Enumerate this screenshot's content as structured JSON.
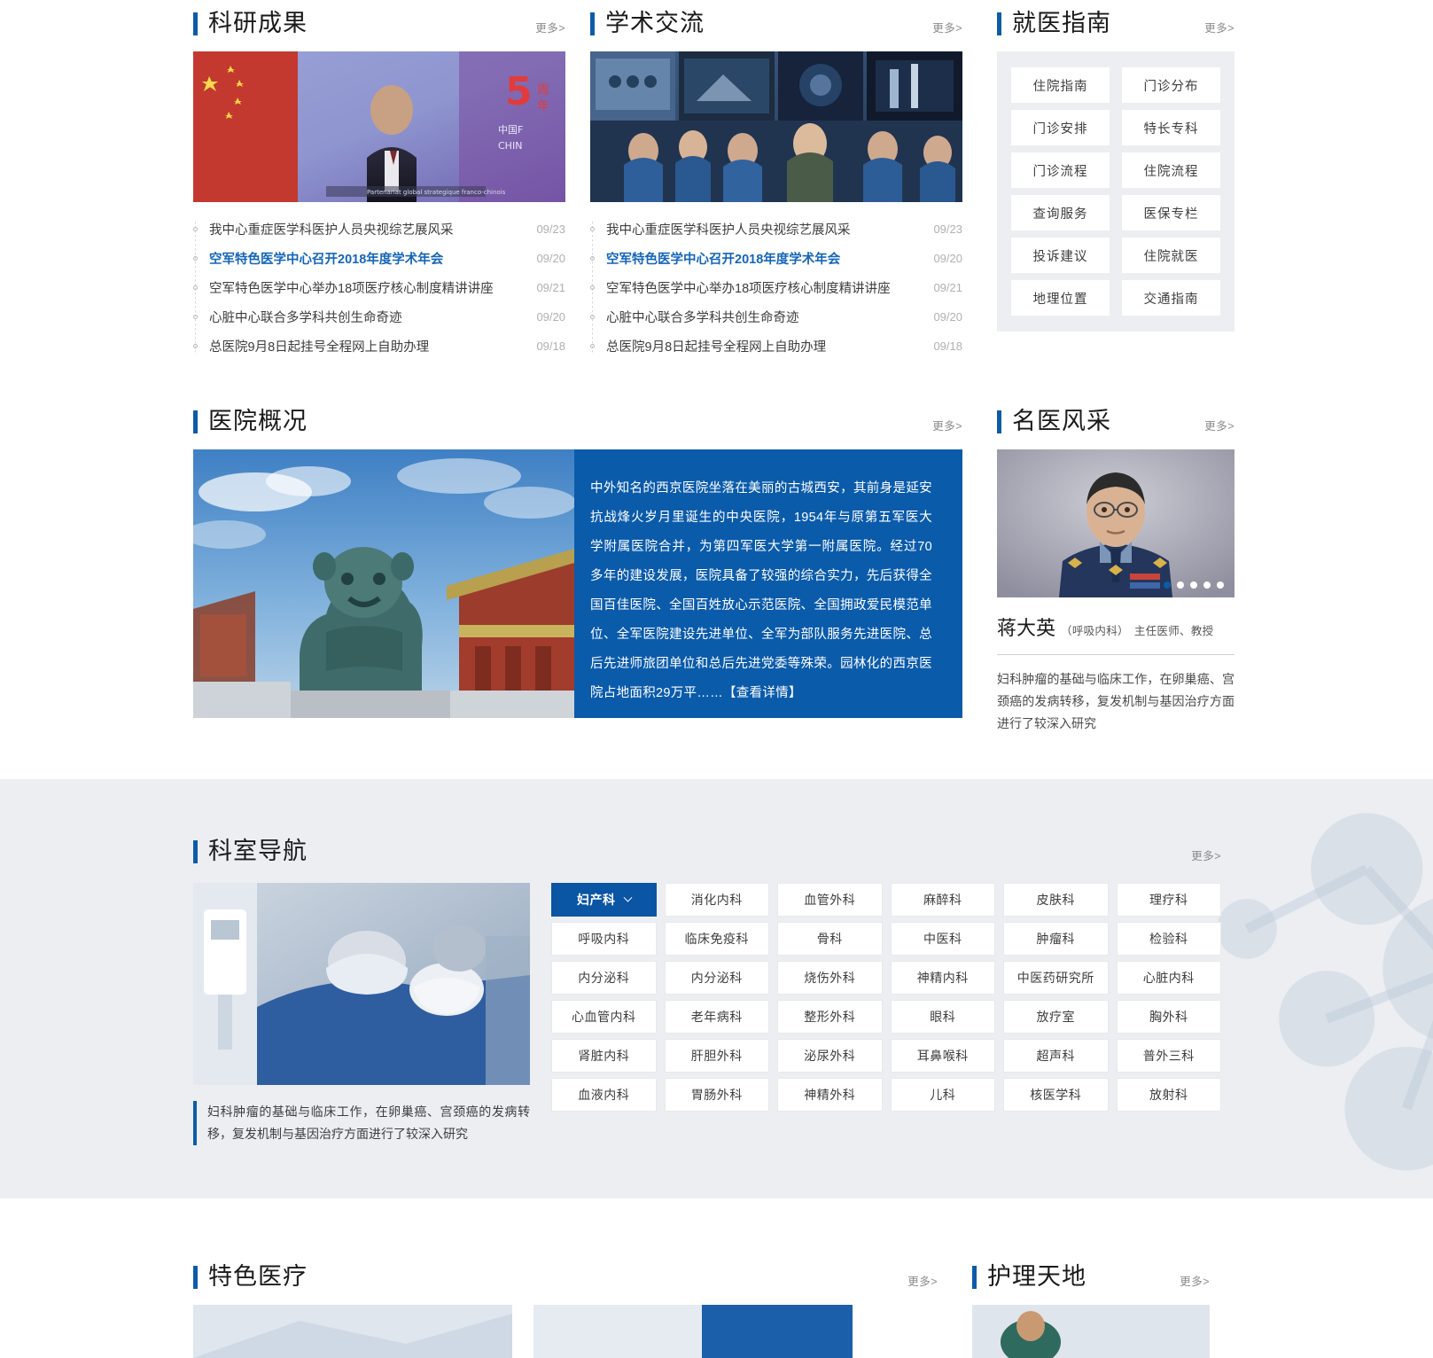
{
  "common": {
    "more_label": "更多>"
  },
  "research": {
    "title": "科研成果",
    "more_label": "更多>",
    "items": [
      {
        "text": "我中心重症医学科医护人员央视综艺展风采",
        "date": "09/23",
        "active": false
      },
      {
        "text": "空军特色医学中心召开2018年度学术年会",
        "date": "09/20",
        "active": true
      },
      {
        "text": "空军特色医学中心举办18项医疗核心制度精讲讲座",
        "date": "09/21",
        "active": false
      },
      {
        "text": "心脏中心联合多学科共创生命奇迹",
        "date": "09/20",
        "active": false
      },
      {
        "text": "总医院9月8日起挂号全程网上自助办理",
        "date": "09/18",
        "active": false
      }
    ]
  },
  "academic": {
    "title": "学术交流",
    "more_label": "更多>",
    "items": [
      {
        "text": "我中心重症医学科医护人员央视综艺展风采",
        "date": "09/23",
        "active": false
      },
      {
        "text": "空军特色医学中心召开2018年度学术年会",
        "date": "09/20",
        "active": true
      },
      {
        "text": "空军特色医学中心举办18项医疗核心制度精讲讲座",
        "date": "09/21",
        "active": false
      },
      {
        "text": "心脏中心联合多学科共创生命奇迹",
        "date": "09/20",
        "active": false
      },
      {
        "text": "总医院9月8日起挂号全程网上自助办理",
        "date": "09/18",
        "active": false
      }
    ]
  },
  "guide": {
    "title": "就医指南",
    "more_label": "更多>",
    "buttons": [
      "住院指南",
      "门诊分布",
      "门诊安排",
      "特长专科",
      "门诊流程",
      "住院流程",
      "查询服务",
      "医保专栏",
      "投诉建议",
      "住院就医",
      "地理位置",
      "交通指南"
    ]
  },
  "overview": {
    "title": "医院概况",
    "more_label": "更多>",
    "body": "中外知名的西京医院坐落在美丽的古城西安，其前身是延安抗战烽火岁月里诞生的中央医院，1954年与原第五军医大学附属医院合并，为第四军医大学第一附属医院。经过70多年的建设发展，医院具备了较强的综合实力，先后获得全国百佳医院、全国百姓放心示范医院、全国拥政爱民模范单位、全军医院建设先进单位、全军为部队服务先进医院、总后先进师旅团单位和总后先进党委等殊荣。园林化的西京医院占地面积29万平……",
    "detail_link": "【查看详情】"
  },
  "doctor": {
    "title": "名医风采",
    "more_label": "更多>",
    "name": "蒋大英",
    "department": "（呼吸内科）",
    "rank": "主任医师、教授",
    "bio": "妇科肿瘤的基础与临床工作，在卵巢癌、宫颈癌的发病转移，复发机制与基因治疗方面进行了较深入研究",
    "carousel_dots": 5,
    "carousel_active_index": 0
  },
  "departments": {
    "title": "科室导航",
    "more_label": "更多>",
    "caption": "妇科肿瘤的基础与临床工作，在卵巢癌、宫颈癌的发病转移，复发机制与基因治疗方面进行了较深入研究",
    "active_label": "妇产科",
    "items": [
      "妇产科",
      "消化内科",
      "血管外科",
      "麻醉科",
      "皮肤科",
      "理疗科",
      "呼吸内科",
      "临床免疫科",
      "骨科",
      "中医科",
      "肿瘤科",
      "检验科",
      "内分泌科",
      "内分泌科",
      "烧伤外科",
      "神精内科",
      "中医药研究所",
      "心脏内科",
      "心血管内科",
      "老年病科",
      "整形外科",
      "眼科",
      "放疗室",
      "胸外科",
      "肾脏内科",
      "肝胆外科",
      "泌尿外科",
      "耳鼻喉科",
      "超声科",
      "普外三科",
      "血液内科",
      "胃肠外科",
      "神精外科",
      "儿科",
      "核医学科",
      "放射科"
    ]
  },
  "feature": {
    "title": "特色医疗",
    "more_label": "更多>"
  },
  "nursing": {
    "title": "护理天地",
    "more_label": "更多>"
  },
  "colors": {
    "accent": "#0d5ba8",
    "active_button": "#0a55a4",
    "overview_panel": "#0b5bab",
    "link_highlight": "#1565b8",
    "section_bg": "#eceef2"
  }
}
